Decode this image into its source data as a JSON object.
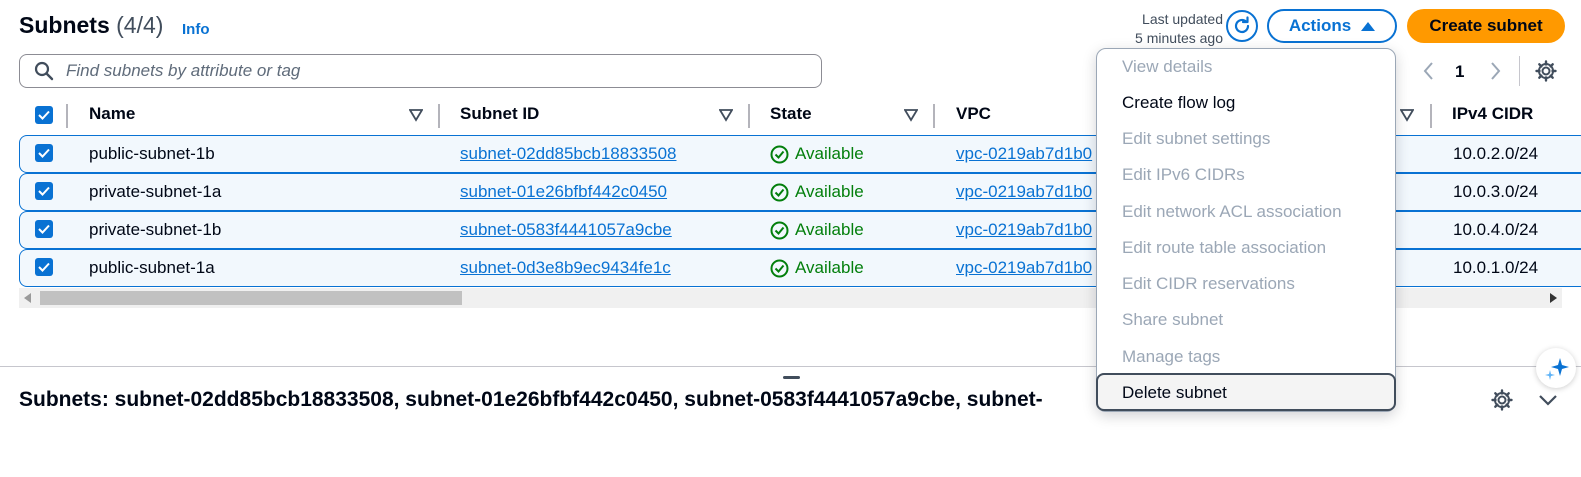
{
  "header": {
    "title": "Subnets",
    "count": "(4/4)",
    "info": "Info",
    "last_updated_line1": "Last updated",
    "last_updated_line2": "5 minutes ago",
    "actions_label": "Actions",
    "create_label": "Create subnet"
  },
  "search": {
    "placeholder": "Find subnets by attribute or tag"
  },
  "pagination": {
    "current_page": "1"
  },
  "table": {
    "columns": [
      "Name",
      "Subnet ID",
      "State",
      "VPC",
      "IPv4 CIDR"
    ],
    "rows": [
      {
        "name": "public-subnet-1b",
        "subnet_id": "subnet-02dd85bcb18833508",
        "state": "Available",
        "vpc": "vpc-0219ab7d1b0",
        "cidr": "10.0.2.0/24"
      },
      {
        "name": "private-subnet-1a",
        "subnet_id": "subnet-01e26bfbf442c0450",
        "state": "Available",
        "vpc": "vpc-0219ab7d1b0",
        "cidr": "10.0.3.0/24"
      },
      {
        "name": "private-subnet-1b",
        "subnet_id": "subnet-0583f4441057a9cbe",
        "state": "Available",
        "vpc": "vpc-0219ab7d1b0",
        "cidr": "10.0.4.0/24"
      },
      {
        "name": "public-subnet-1a",
        "subnet_id": "subnet-0d3e8b9ec9434fe1c",
        "state": "Available",
        "vpc": "vpc-0219ab7d1b0",
        "cidr": "10.0.1.0/24"
      }
    ]
  },
  "split_panel": {
    "title": "Subnets: subnet-02dd85bcb18833508, subnet-01e26bfbf442c0450, subnet-0583f4441057a9cbe, subnet-"
  },
  "actions_menu": {
    "items": [
      {
        "label": "View details",
        "enabled": false
      },
      {
        "label": "Create flow log",
        "enabled": true
      },
      {
        "label": "Edit subnet settings",
        "enabled": false
      },
      {
        "label": "Edit IPv6 CIDRs",
        "enabled": false
      },
      {
        "label": "Edit network ACL association",
        "enabled": false
      },
      {
        "label": "Edit route table association",
        "enabled": false
      },
      {
        "label": "Edit CIDR reservations",
        "enabled": false
      },
      {
        "label": "Share subnet",
        "enabled": false
      },
      {
        "label": "Manage tags",
        "enabled": false
      },
      {
        "label": "Delete subnet",
        "enabled": true
      }
    ]
  },
  "colors": {
    "primary": "#0972d3",
    "accent": "#ff9900",
    "success": "#037f0c",
    "disabled": "#9ba7b6"
  },
  "icons": [
    "search-icon",
    "refresh-icon",
    "caret-up-icon",
    "chevron-left-icon",
    "chevron-right-icon",
    "gear-icon",
    "sort-icon",
    "check-circle-icon",
    "checkbox-checked-icon",
    "chevron-down-icon"
  ]
}
